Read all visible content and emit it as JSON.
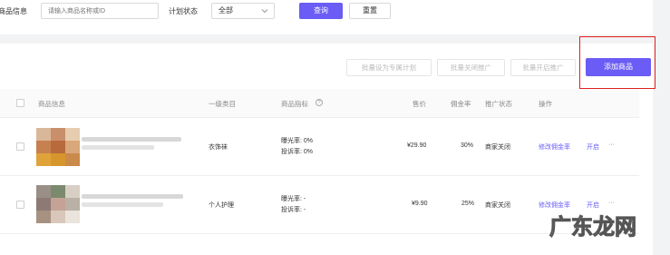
{
  "filters": {
    "product_info_label": "商品信息",
    "product_search_placeholder": "请输入商品名称或ID",
    "plan_status_label": "计划状态",
    "plan_status_value": "全部",
    "query_button": "查询",
    "reset_button": "重置"
  },
  "toolbar": {
    "batch_set_plan": "批量设为专属计划",
    "batch_close": "批量关闭推广",
    "batch_open": "批量开启推广",
    "add_product": "添加商品"
  },
  "table": {
    "columns": [
      "商品信息",
      "一级类目",
      "商品指标",
      "售价",
      "佣金率",
      "推广状态",
      "操作"
    ],
    "rows": [
      {
        "category": "衣饰袜",
        "metric_exposure": "曝光率: 0%",
        "metric_ctr": "投诉率: 0%",
        "price": "¥29.90",
        "commission": "30%",
        "status": "商家关闭",
        "action_edit": "修改佣金率",
        "action_open": "开启",
        "action_more": "···"
      },
      {
        "category": "个人护理",
        "metric_exposure": "曝光率: -",
        "metric_ctr": "投诉率: -",
        "price": "¥9.90",
        "commission": "25%",
        "status": "商家关闭",
        "action_edit": "修改佣金率",
        "action_open": "开启",
        "action_more": "···"
      }
    ]
  },
  "watermark": "广东龙网",
  "colors": {
    "primary": "#6a5cf5",
    "highlight": "#e02020"
  }
}
